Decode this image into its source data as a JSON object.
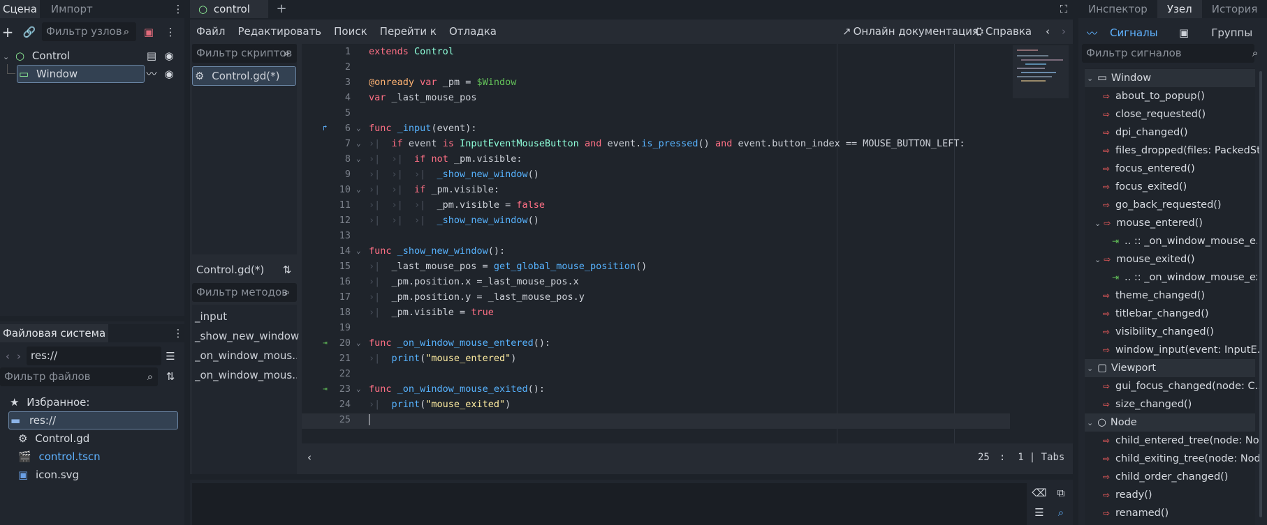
{
  "left_dock": {
    "tabs": [
      "Сцена",
      "Импорт"
    ],
    "filter_nodes_placeholder": "Фильтр узлов",
    "tree": [
      {
        "label": "Control"
      },
      {
        "label": "Window"
      }
    ]
  },
  "filesystem": {
    "tab": "Файловая система",
    "path": "res://",
    "filter_placeholder": "Фильтр файлов",
    "favorites": "Избранное:",
    "root": "res://",
    "items": [
      "Control.gd",
      "control.tscn",
      "icon.svg"
    ]
  },
  "editor": {
    "tab": "control",
    "menu": [
      "Файл",
      "Редактировать",
      "Поиск",
      "Перейти к",
      "Отладка"
    ],
    "online_docs": "Онлайн документация",
    "help": "Справка",
    "script_filter_placeholder": "Фильтр скриптов",
    "scripts": [
      "Control.gd(*)"
    ],
    "current_script": "Control.gd(*)",
    "method_filter_placeholder": "Фильтр методов",
    "methods": [
      "_input",
      "_show_new_window",
      "_on_window_mous...",
      "_on_window_mous..."
    ],
    "status": {
      "line": "25",
      "sep": ":",
      "col": "1",
      "indent": "| Tabs"
    },
    "code_lines": [
      "1",
      "2",
      "3",
      "4",
      "5",
      "6",
      "7",
      "8",
      "9",
      "10",
      "11",
      "12",
      "13",
      "14",
      "15",
      "16",
      "17",
      "18",
      "19",
      "20",
      "21",
      "22",
      "23",
      "24",
      "25"
    ],
    "code": {
      "l1a": "extends",
      "l1b": "Control",
      "l3a": "@onready",
      "l3b": "var",
      "l3c": "_pm =",
      "l3d": "$Window",
      "l4a": "var",
      "l4b": "_last_mouse_pos",
      "l6a": "func",
      "l6b": "_input",
      "l6c": "(event):",
      "l7a": "if",
      "l7b": "event",
      "l7c": "is",
      "l7d": "InputEventMouseButton",
      "l7e": "and",
      "l7f": "event.",
      "l7g": "is_pressed",
      "l7h": "()",
      "l7i": "and",
      "l7j": "event.button_index == MOUSE_BUTTON_LEFT:",
      "l8a": "if",
      "l8b": "not",
      "l8c": "_pm.visible:",
      "l9a": "_show_new_window",
      "l9b": "()",
      "l10a": "if",
      "l10b": "_pm.visible:",
      "l11a": "_pm.visible =",
      "l11b": "false",
      "l12a": "_show_new_window",
      "l12b": "()",
      "l14a": "func",
      "l14b": "_show_new_window",
      "l14c": "():",
      "l15a": "_last_mouse_pos =",
      "l15b": "get_global_mouse_position",
      "l15c": "()",
      "l16": "_pm.position.x =_last_mouse_pos.x",
      "l17": "_pm.position.y = _last_mouse_pos.y",
      "l18a": "_pm.visible =",
      "l18b": "true",
      "l20a": "func",
      "l20b": "_on_window_mouse_entered",
      "l20c": "():",
      "l21a": "print",
      "l21b": "(",
      "l21c": "\"mouse_entered\"",
      "l21d": ")",
      "l23a": "func",
      "l23b": "_on_window_mouse_exited",
      "l23c": "():",
      "l24a": "print",
      "l24b": "(",
      "l24c": "\"mouse_exited\"",
      "l24d": ")"
    }
  },
  "right_dock": {
    "tabs": [
      "Инспектор",
      "Узел",
      "История"
    ],
    "signals_tab": "Сигналы",
    "groups_tab": "Группы",
    "filter_placeholder": "Фильтр сигналов",
    "sections": {
      "window": "Window",
      "viewport": "Viewport",
      "node": "Node"
    },
    "window_signals": [
      "about_to_popup()",
      "close_requested()",
      "dpi_changed()",
      "files_dropped(files: PackedSt...",
      "focus_entered()",
      "focus_exited()",
      "go_back_requested()",
      "mouse_entered()",
      ".. :: _on_window_mouse_e...",
      "mouse_exited()",
      ".. :: _on_window_mouse_ex...",
      "theme_changed()",
      "titlebar_changed()",
      "visibility_changed()",
      "window_input(event: InputE..."
    ],
    "viewport_signals": [
      "gui_focus_changed(node: C...",
      "size_changed()"
    ],
    "node_signals": [
      "child_entered_tree(node: No...",
      "child_exiting_tree(node: Nod...",
      "child_order_changed()",
      "ready()",
      "renamed()"
    ]
  },
  "colors": {
    "accent": "#5fb2ff",
    "keyword": "#ff7085",
    "function": "#57b3ff",
    "string": "#ffeda1",
    "signal": "#ff5f5f",
    "connected": "#63c259"
  }
}
